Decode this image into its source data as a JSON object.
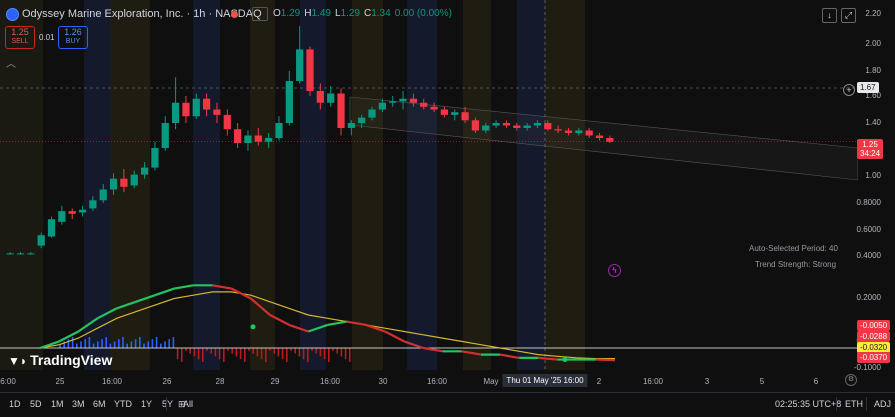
{
  "header": {
    "title": "Odyssey Marine Exploration, Inc. · 1h · NASDAQ",
    "ohlc": [
      {
        "k": "O",
        "v": "1.29"
      },
      {
        "k": "H",
        "v": "1.49"
      },
      {
        "k": "L",
        "v": "1.29"
      },
      {
        "k": "C",
        "v": "1.34"
      },
      {
        "k": "",
        "v": "0.00 (0.00%)"
      }
    ]
  },
  "trade": {
    "sell_price": "1.25",
    "sell_label": "SELL",
    "spread": "0.01",
    "buy_price": "1.26",
    "buy_label": "BUY"
  },
  "y_axis": {
    "ticks": [
      "2.20",
      "2.00",
      "1.80",
      "1.60",
      "1.40",
      "1.20",
      "1.00",
      "0.8000",
      "0.6000",
      "0.4000",
      "0.2000",
      "0.0000",
      "-0.1000"
    ],
    "cursor_price": "1.67",
    "last_price": "1.25",
    "countdown": "34:24",
    "indicator_values": [
      "-0.0050",
      "-0.0288",
      "-0.0320",
      "-0.0370"
    ]
  },
  "x_axis": {
    "ticks": [
      "6:00",
      "25",
      "16:00",
      "26",
      "28",
      "29",
      "16:00",
      "30",
      "16:00",
      "May",
      "16:00",
      "2",
      "16:00",
      "3",
      "5",
      "6"
    ],
    "crosshair_label": "Thu 01 May '25   16:00"
  },
  "overlay": {
    "auto_period": "Auto-Selected Period: 40",
    "trend_strength": "Trend Strength: Strong"
  },
  "branding": {
    "logo": "TradingView"
  },
  "bottom_bar": {
    "ranges": [
      "1D",
      "5D",
      "1M",
      "3M",
      "6M",
      "YTD",
      "1Y",
      "5Y",
      "All"
    ],
    "time": "02:25:35 UTC+8",
    "session": "ETH",
    "adj": "ADJ"
  },
  "colors": {
    "up": "#089981",
    "down": "#f23645",
    "accent": "#2962ff"
  },
  "chart_data": {
    "type": "candlestick",
    "title": "Odyssey Marine Exploration, Inc. · 1h · NASDAQ",
    "ylim": [
      -0.1,
      2.3
    ],
    "candles": [
      [
        0.42,
        0.43,
        0.41,
        0.42
      ],
      [
        0.42,
        0.43,
        0.41,
        0.42
      ],
      [
        0.42,
        0.43,
        0.41,
        0.42
      ],
      [
        0.48,
        0.58,
        0.46,
        0.56
      ],
      [
        0.55,
        0.7,
        0.54,
        0.68
      ],
      [
        0.66,
        0.78,
        0.64,
        0.74
      ],
      [
        0.74,
        0.76,
        0.68,
        0.72
      ],
      [
        0.73,
        0.78,
        0.7,
        0.75
      ],
      [
        0.76,
        0.85,
        0.74,
        0.82
      ],
      [
        0.82,
        0.94,
        0.8,
        0.9
      ],
      [
        0.9,
        1.02,
        0.86,
        0.98
      ],
      [
        0.98,
        1.05,
        0.88,
        0.92
      ],
      [
        0.93,
        1.04,
        0.91,
        1.01
      ],
      [
        1.01,
        1.1,
        0.98,
        1.06
      ],
      [
        1.06,
        1.25,
        1.04,
        1.2
      ],
      [
        1.2,
        1.45,
        1.18,
        1.4
      ],
      [
        1.4,
        1.75,
        1.35,
        1.55
      ],
      [
        1.55,
        1.6,
        1.4,
        1.45
      ],
      [
        1.45,
        1.62,
        1.43,
        1.58
      ],
      [
        1.58,
        1.62,
        1.45,
        1.5
      ],
      [
        1.5,
        1.55,
        1.4,
        1.46
      ],
      [
        1.46,
        1.5,
        1.3,
        1.35
      ],
      [
        1.35,
        1.4,
        1.2,
        1.24
      ],
      [
        1.24,
        1.34,
        1.18,
        1.3
      ],
      [
        1.3,
        1.36,
        1.22,
        1.25
      ],
      [
        1.25,
        1.32,
        1.2,
        1.28
      ],
      [
        1.28,
        1.45,
        1.26,
        1.4
      ],
      [
        1.4,
        1.8,
        1.38,
        1.72
      ],
      [
        1.72,
        2.12,
        1.7,
        1.96
      ],
      [
        1.96,
        1.98,
        1.6,
        1.64
      ],
      [
        1.64,
        1.7,
        1.5,
        1.55
      ],
      [
        1.55,
        1.68,
        1.52,
        1.62
      ],
      [
        1.62,
        1.66,
        1.3,
        1.36
      ],
      [
        1.36,
        1.42,
        1.3,
        1.4
      ],
      [
        1.4,
        1.46,
        1.36,
        1.44
      ],
      [
        1.44,
        1.52,
        1.42,
        1.5
      ],
      [
        1.5,
        1.58,
        1.48,
        1.55
      ],
      [
        1.55,
        1.6,
        1.52,
        1.56
      ],
      [
        1.56,
        1.64,
        1.5,
        1.58
      ],
      [
        1.58,
        1.62,
        1.52,
        1.55
      ],
      [
        1.55,
        1.58,
        1.5,
        1.52
      ],
      [
        1.52,
        1.55,
        1.48,
        1.5
      ],
      [
        1.5,
        1.52,
        1.44,
        1.46
      ],
      [
        1.46,
        1.5,
        1.42,
        1.48
      ],
      [
        1.48,
        1.52,
        1.4,
        1.42
      ],
      [
        1.42,
        1.44,
        1.32,
        1.34
      ],
      [
        1.34,
        1.4,
        1.32,
        1.38
      ],
      [
        1.38,
        1.42,
        1.36,
        1.4
      ],
      [
        1.4,
        1.42,
        1.36,
        1.38
      ],
      [
        1.38,
        1.4,
        1.34,
        1.36
      ],
      [
        1.36,
        1.4,
        1.34,
        1.38
      ],
      [
        1.38,
        1.42,
        1.36,
        1.4
      ],
      [
        1.4,
        1.42,
        1.34,
        1.35
      ],
      [
        1.35,
        1.38,
        1.32,
        1.34
      ],
      [
        1.34,
        1.36,
        1.3,
        1.32
      ],
      [
        1.32,
        1.36,
        1.3,
        1.34
      ],
      [
        1.34,
        1.36,
        1.28,
        1.3
      ],
      [
        1.3,
        1.32,
        1.26,
        1.28
      ],
      [
        1.28,
        1.3,
        1.24,
        1.25
      ]
    ],
    "oscillator": {
      "fast": [
        0.0,
        0.02,
        0.05,
        0.09,
        0.12,
        0.14,
        0.16,
        0.18,
        0.19,
        0.19,
        0.18,
        0.15,
        0.1,
        0.07,
        0.05,
        0.07,
        0.08,
        0.07,
        0.05,
        0.02,
        0.0,
        -0.01,
        -0.01,
        -0.02,
        -0.02,
        -0.03,
        -0.03,
        -0.035,
        -0.035,
        -0.035,
        -0.037
      ],
      "slow": [
        0.0,
        0.01,
        0.03,
        0.06,
        0.09,
        0.11,
        0.13,
        0.15,
        0.16,
        0.17,
        0.17,
        0.16,
        0.14,
        0.12,
        0.1,
        0.09,
        0.08,
        0.07,
        0.06,
        0.05,
        0.04,
        0.03,
        0.02,
        0.01,
        0.0,
        -0.01,
        -0.02,
        -0.025,
        -0.03,
        -0.032,
        -0.032
      ]
    }
  }
}
